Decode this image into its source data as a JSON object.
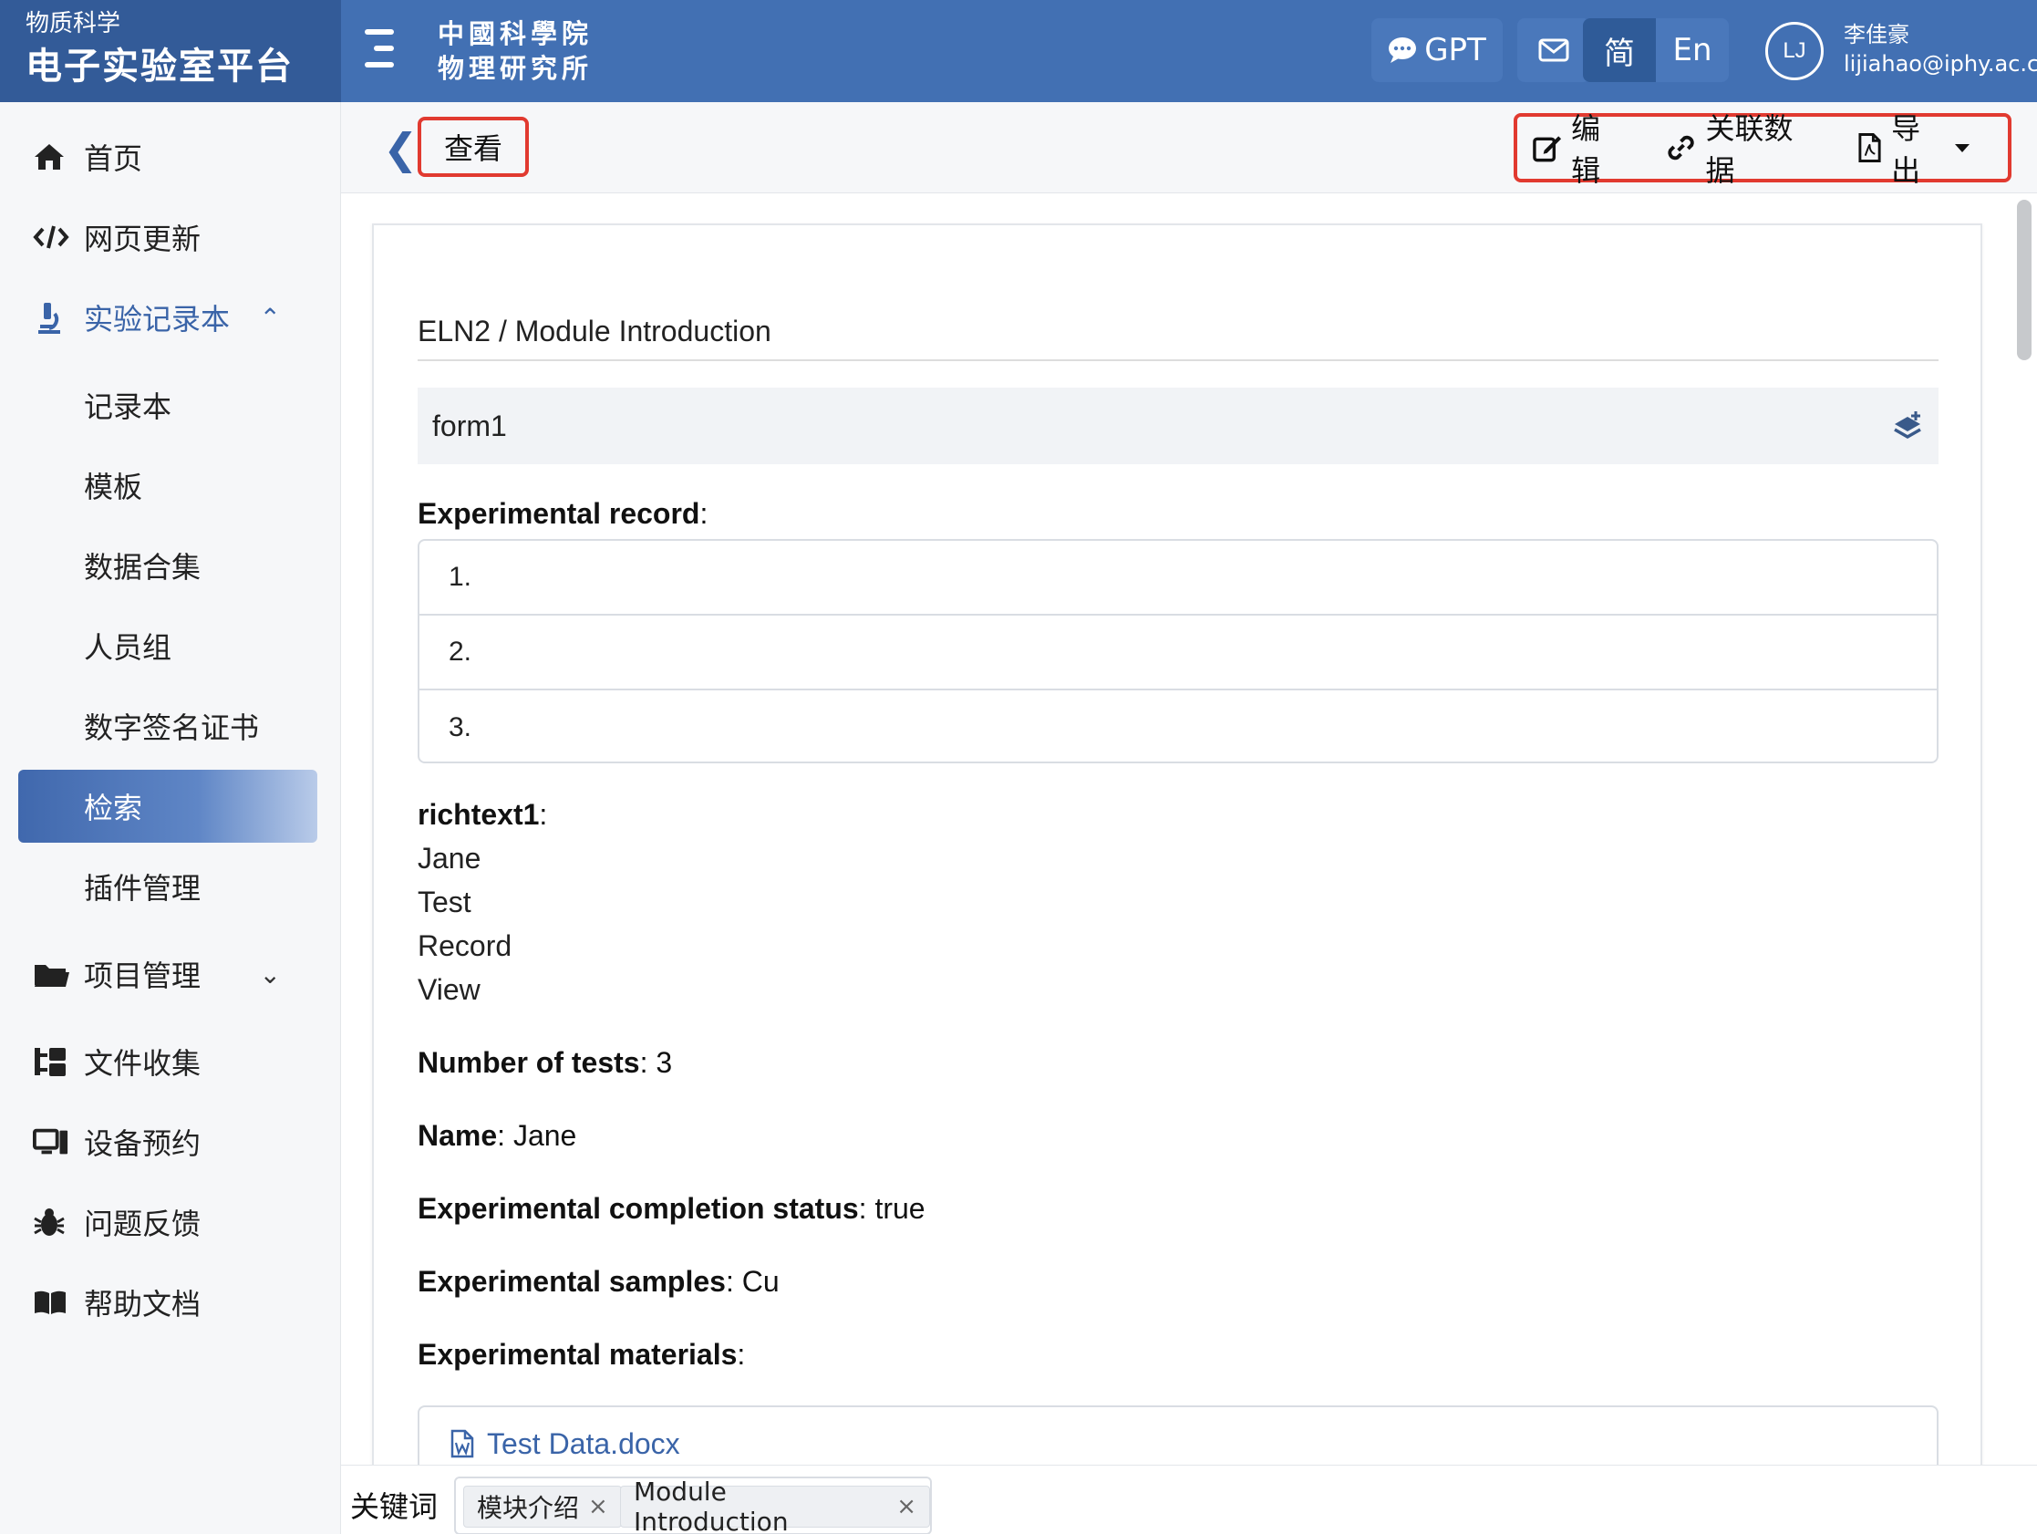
{
  "brand": {
    "small": "物质科学",
    "big": "电子实验室平台"
  },
  "header": {
    "institute_line1": "中國科學院",
    "institute_line2": "物理研究所",
    "gpt_label": "GPT",
    "lang_zh": "简",
    "lang_en": "En",
    "avatar_initials": "LJ",
    "user_name": "李佳豪",
    "user_email": "lijiahao@iphy.ac.cn"
  },
  "sidebar": {
    "home": "首页",
    "web_update": "网页更新",
    "notebook_group": "实验记录本",
    "sub_items": [
      "记录本",
      "模板",
      "数据合集",
      "人员组",
      "数字签名证书",
      "检索",
      "插件管理"
    ],
    "project_mgmt": "项目管理",
    "file_collect": "文件收集",
    "device_booking": "设备预约",
    "feedback": "问题反馈",
    "help_docs": "帮助文档"
  },
  "subheader": {
    "view_label": "查看",
    "edit_label": "编辑",
    "link_data_label": "关联数据",
    "export_label": "导出"
  },
  "content": {
    "breadcrumb": "ELN2 / Module Introduction",
    "form_name": "form1",
    "experimental_record_label": "Experimental record",
    "record_items": [
      "1.",
      "2.",
      "3."
    ],
    "richtext_label": "richtext1",
    "richtext_lines": [
      "Jane",
      "Test",
      "Record",
      "View"
    ],
    "num_tests_label": "Number of tests",
    "num_tests_value": "3",
    "name_label": "Name",
    "name_value": "Jane",
    "completion_label": "Experimental completion status",
    "completion_value": "true",
    "samples_label": "Experimental samples",
    "samples_value": "Cu",
    "materials_label": "Experimental materials",
    "material_file": "Test Data.docx"
  },
  "keywords": {
    "label": "关键词",
    "tags": [
      "模块介绍",
      "Module Introduction"
    ]
  },
  "colors": {
    "header_blue": "#4270b3",
    "brand_blue": "#335b98",
    "accent": "#3a64a8",
    "highlight_red": "#e13a30"
  }
}
